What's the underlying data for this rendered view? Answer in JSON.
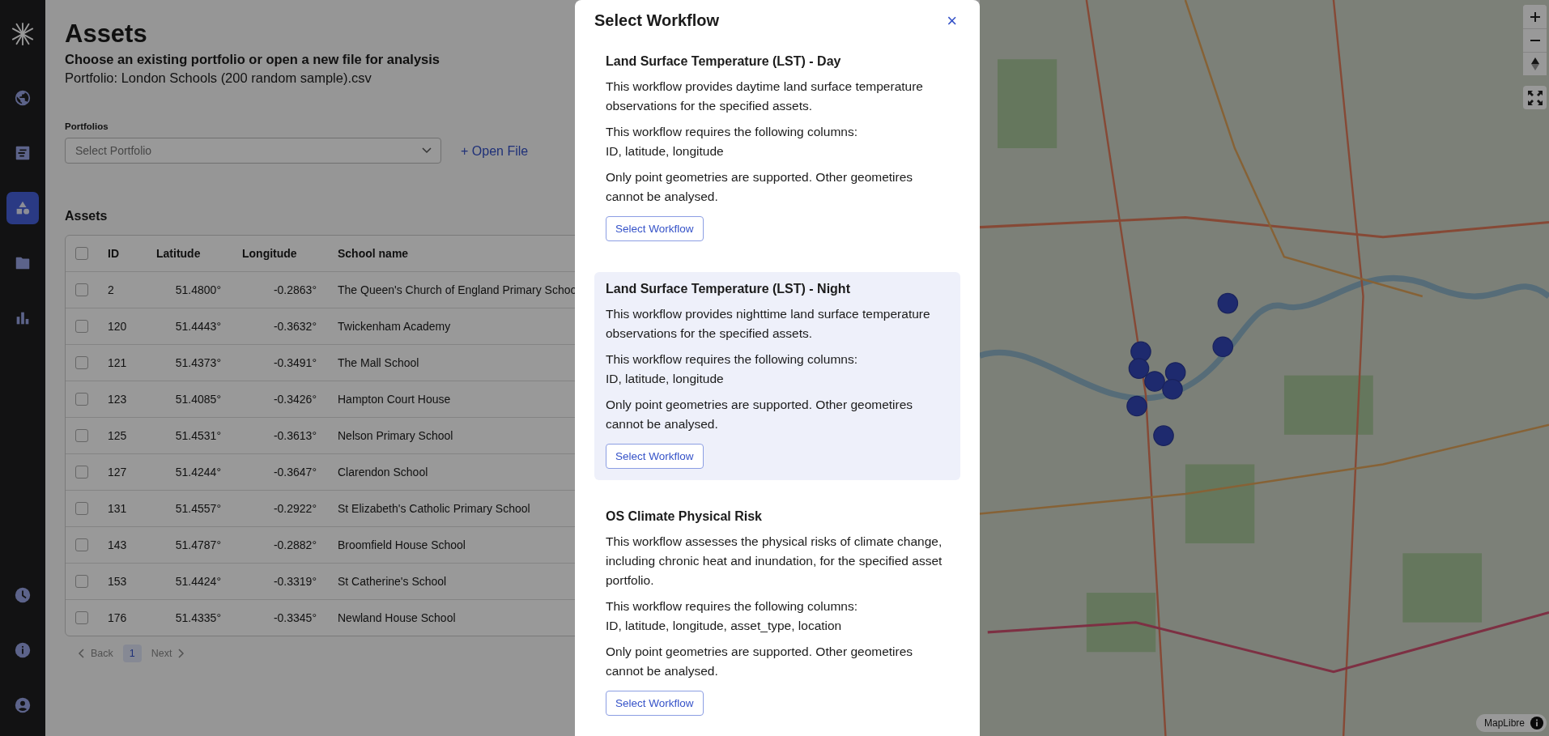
{
  "sidebar": {
    "top_items": [
      {
        "selected": false
      },
      {
        "selected": false
      },
      {
        "selected": true
      },
      {
        "selected": false
      },
      {
        "selected": false
      }
    ],
    "bottom_items": [
      {
        "selected": false
      },
      {
        "selected": false
      },
      {
        "selected": false
      }
    ]
  },
  "page": {
    "title": "Assets",
    "subtitle": "Choose an existing portfolio or open a new file for analysis",
    "portfolio_line": "Portfolio: London Schools (200 random sample).csv"
  },
  "portfolio_select": {
    "label": "Portfolios",
    "placeholder": "Select Portfolio"
  },
  "open_file": "+ Open File",
  "table": {
    "title": "Assets",
    "select_all_checked": false,
    "columns": [
      "ID",
      "Latitude",
      "Longitude",
      "School name"
    ],
    "rows": [
      {
        "checked": false,
        "cells": [
          "2",
          "51.4800°",
          "-0.2863°",
          "The Queen's Church of England Primary Schoo"
        ]
      },
      {
        "checked": false,
        "cells": [
          "120",
          "51.4443°",
          "-0.3632°",
          "Twickenham Academy"
        ]
      },
      {
        "checked": false,
        "cells": [
          "121",
          "51.4373°",
          "-0.3491°",
          "The Mall School"
        ]
      },
      {
        "checked": false,
        "cells": [
          "123",
          "51.4085°",
          "-0.3426°",
          "Hampton Court House"
        ]
      },
      {
        "checked": false,
        "cells": [
          "125",
          "51.4531°",
          "-0.3613°",
          "Nelson Primary School"
        ]
      },
      {
        "checked": false,
        "cells": [
          "127",
          "51.4244°",
          "-0.3647°",
          "Clarendon School"
        ]
      },
      {
        "checked": false,
        "cells": [
          "131",
          "51.4557°",
          "-0.2922°",
          "St Elizabeth's Catholic Primary School"
        ]
      },
      {
        "checked": false,
        "cells": [
          "143",
          "51.4787°",
          "-0.2882°",
          "Broomfield House School"
        ]
      },
      {
        "checked": false,
        "cells": [
          "153",
          "51.4424°",
          "-0.3319°",
          "St Catherine's School"
        ]
      },
      {
        "checked": false,
        "cells": [
          "176",
          "51.4335°",
          "-0.3345°",
          "Newland House School"
        ]
      }
    ]
  },
  "pagination": {
    "back": {
      "label": "Back",
      "disabled": true
    },
    "pages": [
      {
        "label": "1",
        "selected": true
      }
    ],
    "next": {
      "label": "Next",
      "disabled": true
    }
  },
  "modal": {
    "title": "Select Workflow",
    "close": "×",
    "workflows": [
      {
        "title": "Land Surface Temperature (LST) - Day",
        "selected": false,
        "description": "This workflow provides daytime land surface temperature observations for the specified assets.",
        "requirements": "This workflow requires the following columns:",
        "columns": "ID, latitude, longitude",
        "note": "Only point geometries are supported. Other geometires cannot be analysed.",
        "button": "Select Workflow"
      },
      {
        "title": "Land Surface Temperature (LST) - Night",
        "selected": true,
        "description": "This workflow provides nighttime land surface temperature observations for the specified assets.",
        "requirements": "This workflow requires the following columns:",
        "columns": "ID, latitude, longitude",
        "note": "Only point geometries are supported. Other geometires cannot be analysed.",
        "button": "Select Workflow"
      },
      {
        "title": "OS Climate Physical Risk",
        "selected": false,
        "description": "This workflow assesses the physical risks of climate change, including chronic heat and inundation, for the specified asset portfolio.",
        "requirements": "This workflow requires the following columns:",
        "columns": "ID, latitude, longitude, asset_type, location",
        "note": "Only point geometries are supported. Other geometires cannot be analysed.",
        "button": "Select Workflow"
      }
    ]
  },
  "map": {
    "attribution": "MapLibre"
  }
}
